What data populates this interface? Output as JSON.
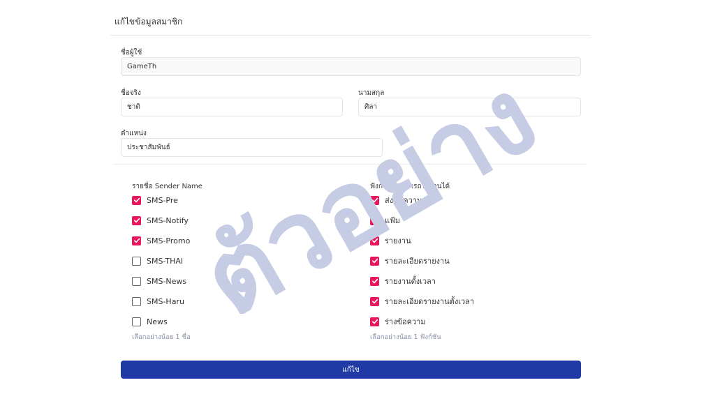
{
  "form": {
    "title": "แก้ไขข้อมูลสมาชิก",
    "username": {
      "label": "ชื่อผู้ใช้",
      "value": "GameTh"
    },
    "firstname": {
      "label": "ชื่อจริง",
      "value": "ชาติ"
    },
    "lastname": {
      "label": "นามสกุล",
      "value": "ศิลา"
    },
    "position": {
      "label": "ตำแหน่ง",
      "value": "ประชาสัมพันธ์"
    },
    "submit_label": "แก้ไข"
  },
  "sender_names": {
    "title": "รายชื่อ Sender Name",
    "items": [
      {
        "label": "SMS-Pre",
        "checked": true
      },
      {
        "label": "SMS-Notify",
        "checked": true
      },
      {
        "label": "SMS-Promo",
        "checked": true
      },
      {
        "label": "SMS-THAI",
        "checked": false
      },
      {
        "label": "SMS-News",
        "checked": false
      },
      {
        "label": "SMS-Haru",
        "checked": false
      },
      {
        "label": "News",
        "checked": false
      }
    ],
    "hint": "เลือกอย่างน้อย 1 ชื่อ"
  },
  "functions": {
    "title": "ฟังก์ชันที่สามารถใช้งานได้",
    "items": [
      {
        "label": "ส่งข้อความ",
        "checked": true
      },
      {
        "label": "แฟ้ม",
        "checked": true
      },
      {
        "label": "รายงาน",
        "checked": true
      },
      {
        "label": "รายละเอียดรายงาน",
        "checked": true
      },
      {
        "label": "รายงานตั้งเวลา",
        "checked": true
      },
      {
        "label": "รายละเอียดรายงานตั้งเวลา",
        "checked": true
      },
      {
        "label": "ร่างข้อความ",
        "checked": true
      }
    ],
    "hint": "เลือกอย่างน้อย 1 ฟังก์ชัน"
  },
  "watermark": {
    "text": "ตัวอย่าง",
    "color": "#c5cce4"
  },
  "colors": {
    "accent": "#e8175d",
    "primary": "#1f3aa5"
  }
}
